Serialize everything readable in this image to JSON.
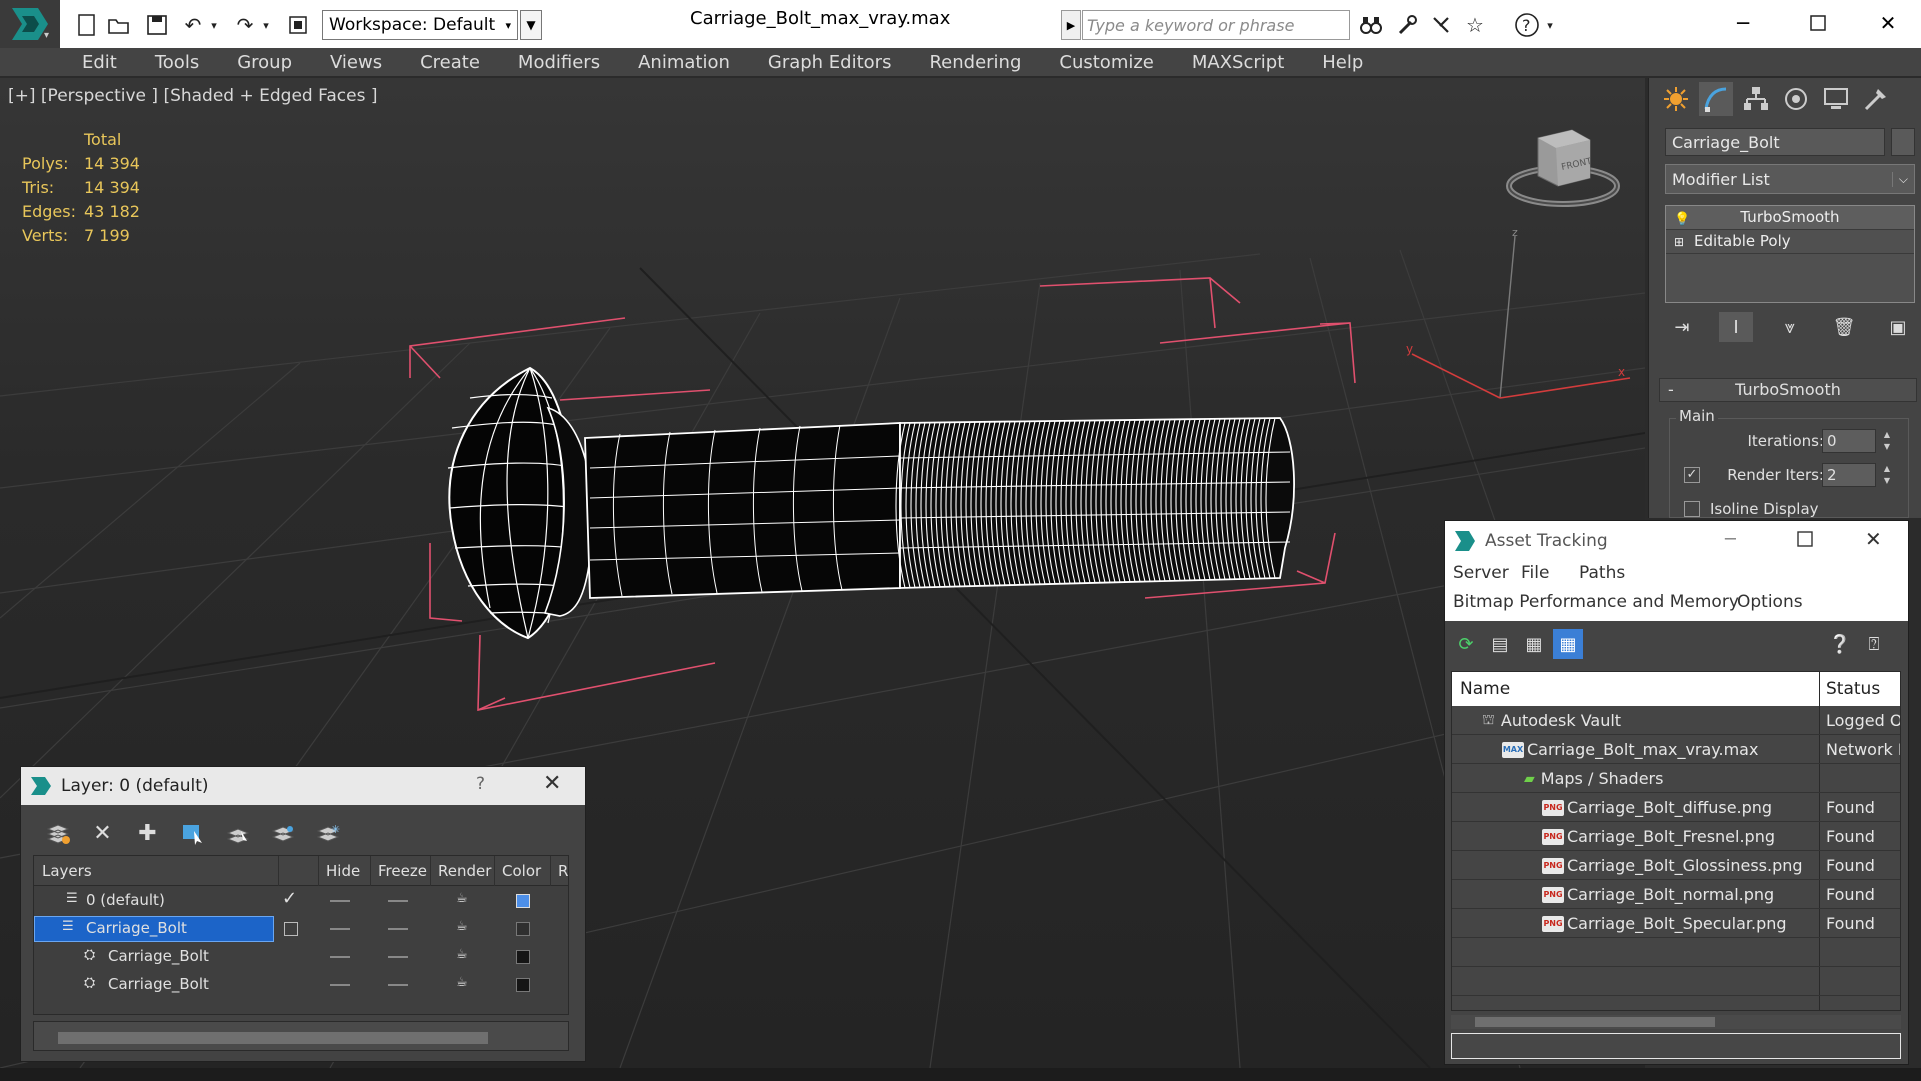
{
  "titlebar": {
    "workspace": "Workspace: Default",
    "document_title": "Carriage_Bolt_max_vray.max",
    "search_placeholder": "Type a keyword or phrase"
  },
  "menu": [
    "Edit",
    "Tools",
    "Group",
    "Views",
    "Create",
    "Modifiers",
    "Animation",
    "Graph Editors",
    "Rendering",
    "Customize",
    "MAXScript",
    "Help"
  ],
  "viewport": {
    "label": "[+] [Perspective ] [Shaded + Edged Faces ]",
    "stats": {
      "header": "Total",
      "rows": [
        {
          "label": "Polys:",
          "value": "14 394"
        },
        {
          "label": "Tris:",
          "value": "14 394"
        },
        {
          "label": "Edges:",
          "value": "43 182"
        },
        {
          "label": "Verts:",
          "value": "7 199"
        }
      ]
    },
    "viewcube_face": "FRONT",
    "axis_labels": {
      "x": "x",
      "y": "y",
      "z": "z"
    }
  },
  "command_panel": {
    "object_name": "Carriage_Bolt",
    "modifier_list": "Modifier List",
    "stack": [
      "TurboSmooth",
      "Editable Poly"
    ],
    "rollout_title": "TurboSmooth",
    "main_group": "Main",
    "iterations_label": "Iterations:",
    "iterations_value": "0",
    "render_iters_label": "Render Iters:",
    "render_iters_value": "2",
    "isoline_label": "Isoline Display"
  },
  "layer_dialog": {
    "title": "Layer: 0 (default)",
    "help": "?",
    "columns": [
      "Layers",
      "Hide",
      "Freeze",
      "Render",
      "Color",
      "R"
    ],
    "rows": [
      {
        "name": "0 (default)",
        "selected": false
      },
      {
        "name": "Carriage_Bolt",
        "selected": true
      },
      {
        "name": "Carriage_Bolt",
        "selected": false
      },
      {
        "name": "Carriage_Bolt",
        "selected": false
      }
    ]
  },
  "asset_tracking": {
    "title": "Asset Tracking",
    "menu_row1": [
      "Server",
      "File",
      "Paths"
    ],
    "menu_row2": [
      "Bitmap Performance and Memory",
      "Options"
    ],
    "columns": [
      "Name",
      "Status"
    ],
    "rows": [
      {
        "name": "Autodesk Vault",
        "status": "Logged O",
        "indent": 30,
        "icon": "vault"
      },
      {
        "name": "Carriage_Bolt_max_vray.max",
        "status": "Network F",
        "indent": 50,
        "icon": "max"
      },
      {
        "name": "Maps / Shaders",
        "status": "",
        "indent": 72,
        "icon": "folder"
      },
      {
        "name": "Carriage_Bolt_diffuse.png",
        "status": "Found",
        "indent": 90,
        "icon": "png"
      },
      {
        "name": "Carriage_Bolt_Fresnel.png",
        "status": "Found",
        "indent": 90,
        "icon": "png"
      },
      {
        "name": "Carriage_Bolt_Glossiness.png",
        "status": "Found",
        "indent": 90,
        "icon": "png"
      },
      {
        "name": "Carriage_Bolt_normal.png",
        "status": "Found",
        "indent": 90,
        "icon": "png"
      },
      {
        "name": "Carriage_Bolt_Specular.png",
        "status": "Found",
        "indent": 90,
        "icon": "png"
      }
    ],
    "png_badge": "PNG",
    "max_badge": "MAX"
  }
}
